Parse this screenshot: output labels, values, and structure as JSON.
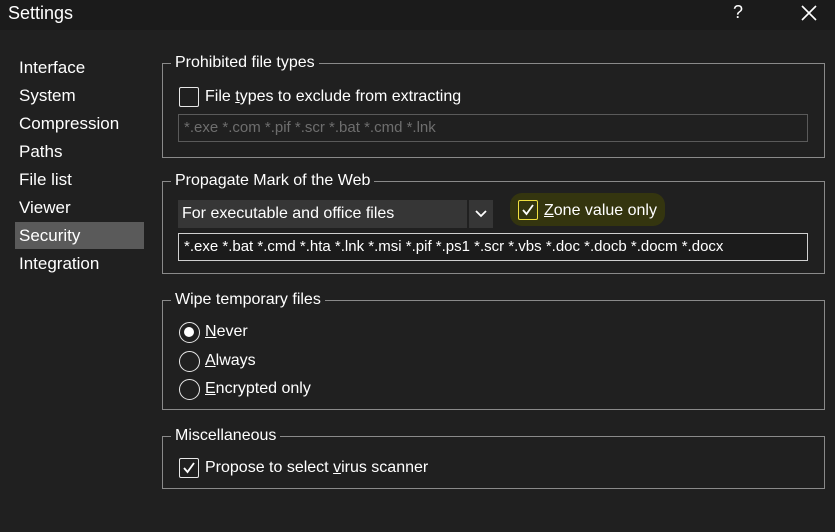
{
  "window": {
    "title": "Settings",
    "help": "?"
  },
  "sidebar": {
    "items": [
      {
        "label": "Interface"
      },
      {
        "label": "System"
      },
      {
        "label": "Compression"
      },
      {
        "label": "Paths"
      },
      {
        "label": "File list"
      },
      {
        "label": "Viewer"
      },
      {
        "label": "Security",
        "selected": true
      },
      {
        "label": "Integration"
      }
    ]
  },
  "prohibited": {
    "legend": "Prohibited file types",
    "checkbox_label_a": "File ",
    "checkbox_label_u": "t",
    "checkbox_label_b": "ypes to exclude from extracting",
    "checked": false,
    "value": "*.exe *.com *.pif *.scr *.bat *.cmd *.lnk"
  },
  "motw": {
    "legend": "Propagate Mark of the Web",
    "dropdown_value": "For executable and office files",
    "zone_u": "Z",
    "zone_rest": "one value only",
    "zone_checked": true,
    "value": "*.exe *.bat *.cmd *.hta *.lnk *.msi *.pif *.ps1 *.scr *.vbs *.doc *.docb *.docm *.docx"
  },
  "wipe": {
    "legend": "Wipe temporary files",
    "options": [
      {
        "u": "N",
        "rest": "ever",
        "selected": true
      },
      {
        "u": "A",
        "rest": "lways",
        "selected": false
      },
      {
        "u": "E",
        "rest": "ncrypted only",
        "selected": false
      }
    ]
  },
  "misc": {
    "legend": "Miscellaneous",
    "label_a": "Propose to select ",
    "label_u": "v",
    "label_b": "irus scanner",
    "checked": true
  },
  "colors": {
    "highlight": "#34350f",
    "highlight_border": "#f0e040",
    "selected_bg": "#5a5a5a"
  }
}
